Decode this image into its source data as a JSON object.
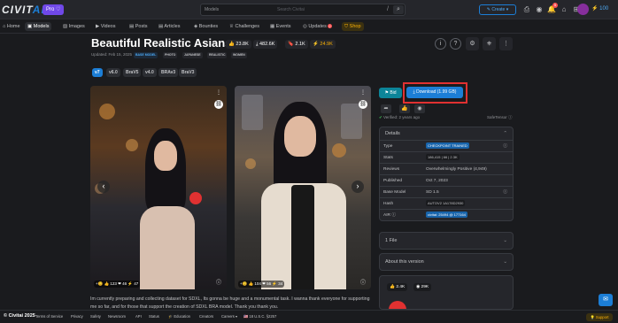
{
  "header": {
    "logo": "CIVITAI",
    "logo_suffix": "AI",
    "pro_badge": "Pro ♡",
    "search_scope": "Models",
    "search_placeholder": "Search Civitai",
    "search_shortcut": "/",
    "create_label": "Create",
    "notif_count": "5",
    "buzz": "100"
  },
  "nav": {
    "items": [
      "Home",
      "Models",
      "Images",
      "Videos",
      "Posts",
      "Articles",
      "Bounties",
      "Challenges",
      "Events",
      "Updates",
      "Shop"
    ],
    "updates_badge": "2",
    "active": "Models"
  },
  "model": {
    "title": "Beautiful Realistic Asians",
    "stats": {
      "likes": "23.8K",
      "downloads": "482.6K",
      "bookmarks": "2.1K",
      "buzz": "24.9K"
    },
    "updated": "Updated: Feb 15, 2025",
    "tags": [
      "BASE MODEL",
      "PHOTO",
      "JAPANESE",
      "REALISTIC",
      "WOMEN"
    ],
    "versions": [
      "v7",
      "v6.0",
      "BraV5",
      "v4.0",
      "BRAv3",
      "BraV3"
    ],
    "active_version": "v7"
  },
  "images": [
    {
      "reactions": "+😊  👍 123  ❤ 46  ⚡ 47"
    },
    {
      "reactions": "+😊  👍 104  ❤ 56  ⚡ 34"
    }
  ],
  "description": "Im currently preparing and collecting dataset for SDXL, Its gonna be huge and a monumental task. I wanna thank everyone for supporting me so far, and for those that support the creation of SDXL BRA model. Thank you thank you.",
  "sidebar": {
    "bid_label": "Bid",
    "download_label": "Download (1.99 GB)",
    "verified": "Verified: 2 years ago",
    "safetensor": "SafeTensor",
    "details_title": "Details",
    "details": [
      {
        "key": "Type",
        "value": "CHECKPOINT TRAINED"
      },
      {
        "key": "Stats",
        "value": "186,415  |  66  |  2.3K"
      },
      {
        "key": "Reviews",
        "value": "Overwhelmingly Positive (4,949)"
      },
      {
        "key": "Published",
        "value": "Oct 7, 2023"
      },
      {
        "key": "Base Model",
        "value": "SD 1.5"
      },
      {
        "key": "Hash",
        "value": "AUTOV2   1A178D2930"
      },
      {
        "key": "AIR",
        "value": "civitai: 25494 @ 177164"
      }
    ],
    "files_title": "1 File",
    "about_title": "About this version",
    "mini_stats": {
      "likes": "2.4K",
      "views": "29K"
    }
  },
  "footer": {
    "copyright": "© Civitai 2025",
    "links": [
      "Terms of Service",
      "Privacy",
      "Safety",
      "Newsroom",
      "API",
      "Status",
      "🎓 Education",
      "Creators",
      "Careers ▾",
      "🇺🇸 18 U.S.C. §2257"
    ],
    "support": "💡 Support"
  }
}
